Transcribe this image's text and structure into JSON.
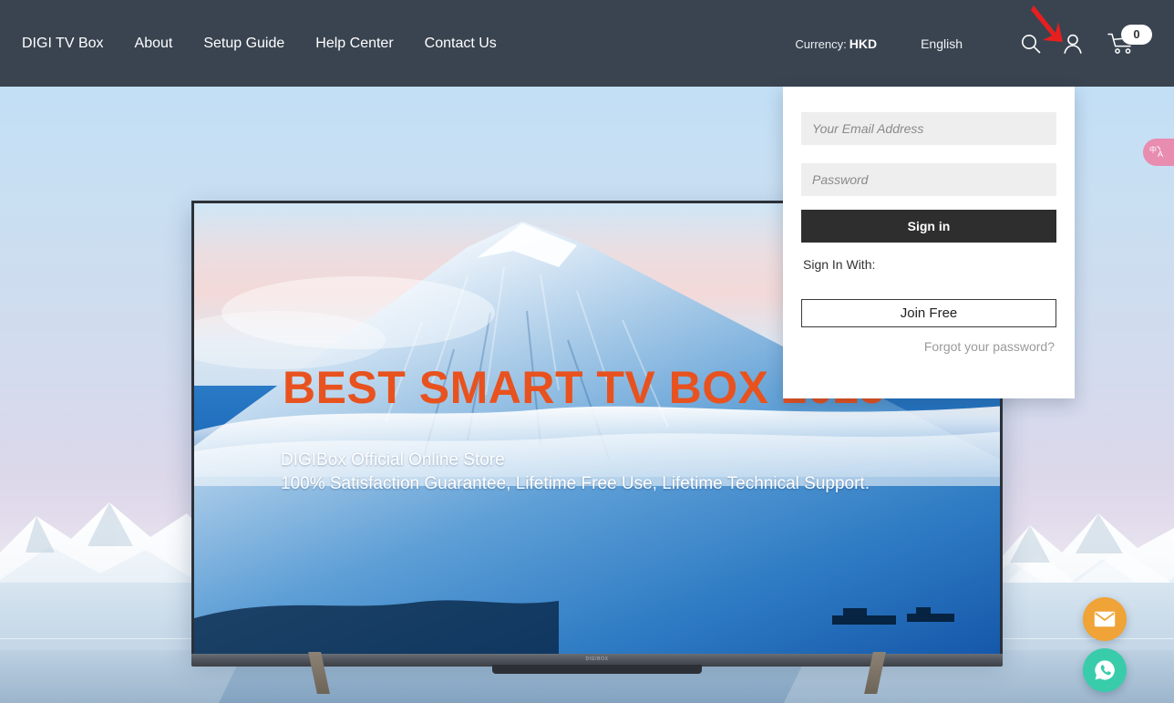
{
  "header": {
    "nav": [
      {
        "label": "DIGI TV Box"
      },
      {
        "label": "About"
      },
      {
        "label": "Setup Guide"
      },
      {
        "label": "Help Center"
      },
      {
        "label": "Contact Us"
      }
    ],
    "currency_label": "Currency:",
    "currency_value": "HKD",
    "language": "English",
    "search_icon": "search-icon",
    "account_icon": "user-account-icon",
    "cart_icon": "shopping-cart-icon",
    "cart_count": "0",
    "background_color": "#3a4450"
  },
  "annotation": {
    "arrow": "red-arrow-pointing-to-account-icon",
    "color": "#e81f1f"
  },
  "login": {
    "email_placeholder": "Your Email Address",
    "email_value": "",
    "password_placeholder": "Password",
    "password_value": "",
    "signin_label": "Sign in",
    "signin_with_label": "Sign In With:",
    "join_label": "Join Free",
    "forgot_label": "Forgot your password?",
    "signin_button_color": "#2e2e2e"
  },
  "hero": {
    "title": "BEST SMART TV BOX 2025",
    "title_color": "#e8521f",
    "subtitle_line1": "DIGIBox Official Online Store",
    "subtitle_line2": "100% Satisfaction Guarantee, Lifetime Free Use, Lifetime Technical Support.",
    "tv_brand_mark": "DIGIBOX"
  },
  "widgets": {
    "translate": "translate-icon",
    "translate_glyph": "中A",
    "translate_color": "#e88cb0",
    "mail": "email-icon",
    "mail_color": "#f0a336",
    "whatsapp": "whatsapp-icon",
    "whatsapp_color": "#38ccab"
  }
}
